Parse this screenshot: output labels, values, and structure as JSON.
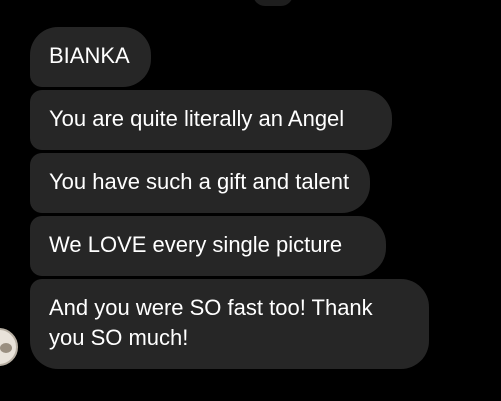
{
  "conversation": {
    "messages": [
      {
        "text": "BIANKA"
      },
      {
        "text": "You are quite literally an Angel"
      },
      {
        "text": "You have such a gift and talent"
      },
      {
        "text": "We LOVE every single picture"
      },
      {
        "text": "And you were SO fast too! Thank you SO much!"
      }
    ],
    "colors": {
      "background": "#000000",
      "bubble": "#262626",
      "text": "#ffffff"
    }
  }
}
